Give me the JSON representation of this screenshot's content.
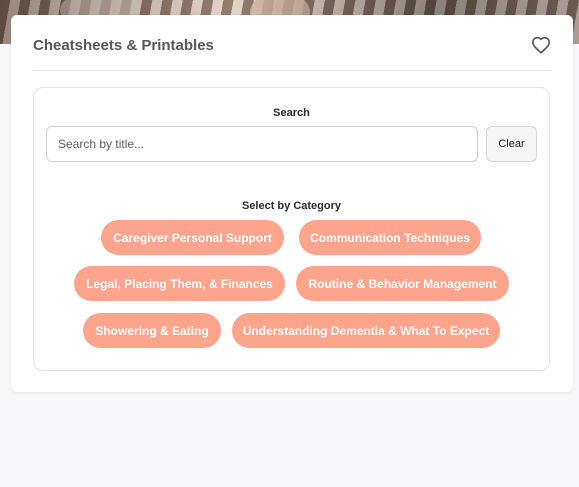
{
  "header": {
    "title": "Cheatsheets & Printables",
    "favorite_icon": "heart-outline-icon"
  },
  "search": {
    "label": "Search",
    "placeholder": "Search by title...",
    "value": "",
    "clear_label": "Clear"
  },
  "categories": {
    "label": "Select by Category",
    "chip_color": "#fca48c",
    "items": [
      "Caregiver Personal Support",
      "Communication Techniques",
      "Legal, Placing Them, & Finances",
      "Routine & Behavior Management",
      "Showering & Eating",
      "Understanding Dementia & What To Expect"
    ]
  }
}
